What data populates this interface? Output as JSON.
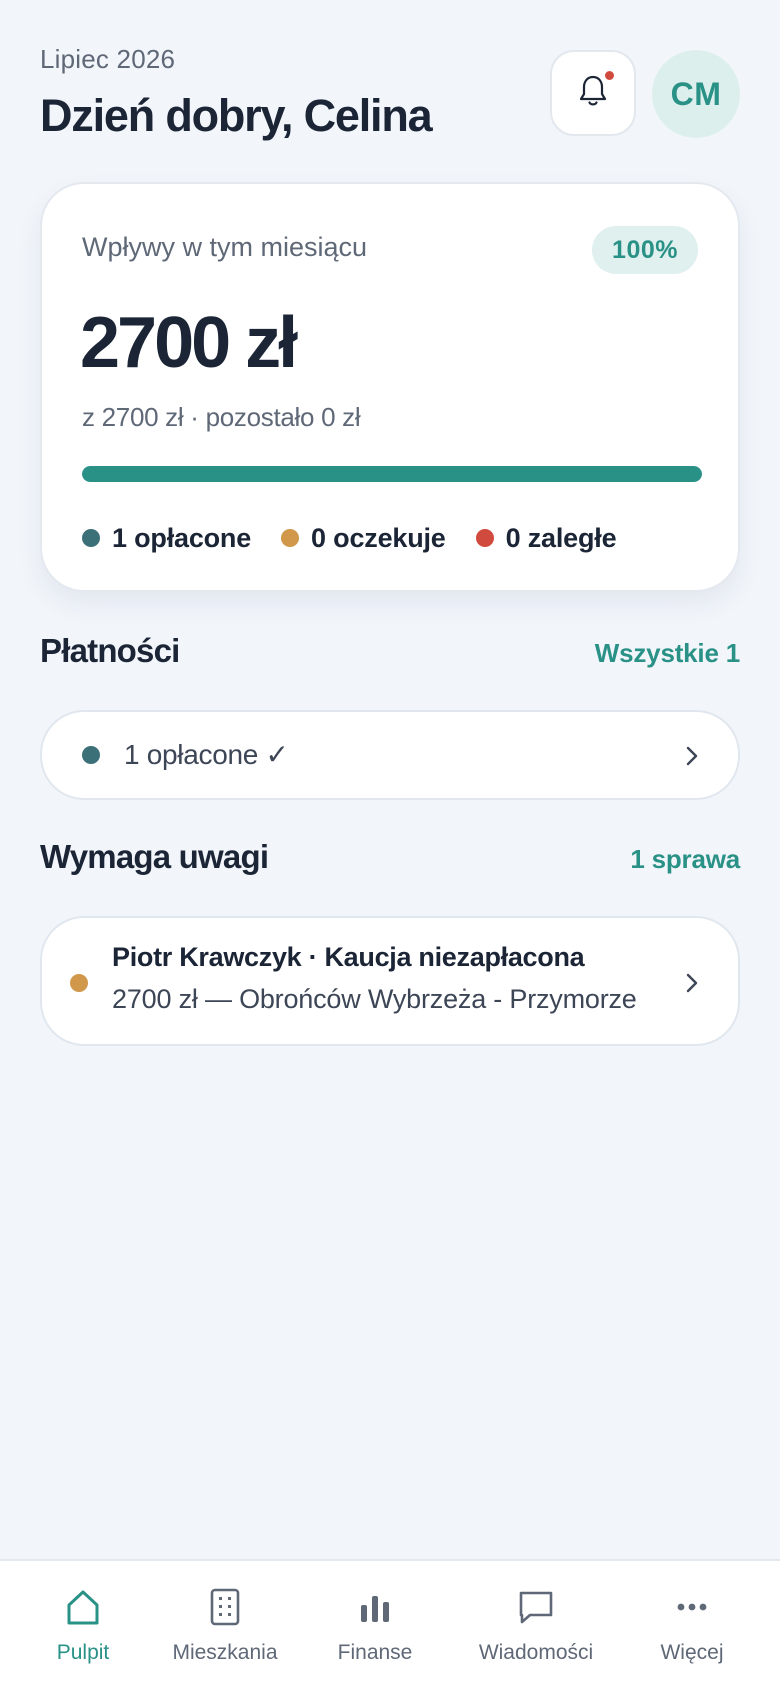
{
  "header": {
    "month": "Lipiec 2026",
    "greeting": "Dzień dobry, Celina",
    "avatar_initials": "CM",
    "has_notification": true
  },
  "summary": {
    "title": "Wpływy w tym miesiącu",
    "percent_label": "100%",
    "progress_fraction": 1.0,
    "amount": "2700 zł",
    "subline": "z 2700 zł · pozostało 0 zł",
    "legend": [
      {
        "label": "1 opłacone",
        "color": "#3C7078"
      },
      {
        "label": "0 oczekuje",
        "color": "#D1974A"
      },
      {
        "label": "0 zaległe",
        "color": "#D14A3E"
      }
    ]
  },
  "payments": {
    "title": "Płatności",
    "link": "Wszystkie 1",
    "row_label": "1 opłacone ✓",
    "row_dot_color": "#3C7078"
  },
  "attention": {
    "title": "Wymaga uwagi",
    "link": "1 sprawa",
    "item_title": "Piotr Krawczyk · Kaucja niezapłacona",
    "item_subtitle": "2700 zł — Obrońców Wybrzeża - Przymorze",
    "item_dot_color": "#D1974A"
  },
  "nav": {
    "items": [
      {
        "label": "Pulpit",
        "icon": "home-icon",
        "active": true
      },
      {
        "label": "Mieszkania",
        "icon": "building-icon",
        "active": false
      },
      {
        "label": "Finanse",
        "icon": "bar-chart-icon",
        "active": false
      },
      {
        "label": "Wiadomości",
        "icon": "message-icon",
        "active": false
      },
      {
        "label": "Więcej",
        "icon": "more-icon",
        "active": false
      }
    ]
  },
  "colors": {
    "accent": "#2A9187",
    "background": "#F2F6FB",
    "text_primary": "#1B2536",
    "text_secondary": "#5F6877"
  }
}
